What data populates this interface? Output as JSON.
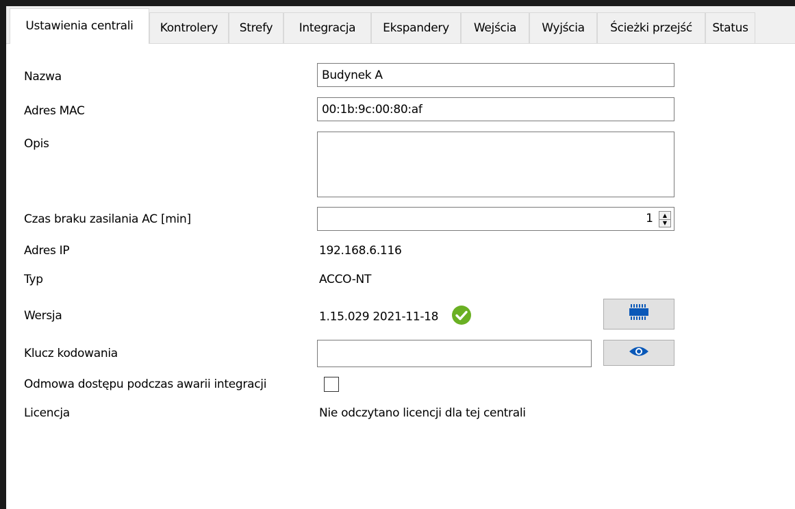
{
  "tabs": [
    {
      "label": "Ustawienia centrali",
      "active": true
    },
    {
      "label": "Kontrolery"
    },
    {
      "label": "Strefy"
    },
    {
      "label": "Integracja"
    },
    {
      "label": "Ekspandery"
    },
    {
      "label": "Wejścia"
    },
    {
      "label": "Wyjścia"
    },
    {
      "label": "Ścieżki przejść"
    },
    {
      "label": "Status"
    }
  ],
  "form": {
    "name_label": "Nazwa",
    "name_value": "Budynek A",
    "mac_label": "Adres MAC",
    "mac_value": "00:1b:9c:00:80:af",
    "desc_label": "Opis",
    "desc_value": "",
    "ac_label": "Czas braku zasilania AC [min]",
    "ac_value": "1",
    "ip_label": "Adres IP",
    "ip_value": "192.168.6.116",
    "type_label": "Typ",
    "type_value": "ACCO-NT",
    "version_label": "Wersja",
    "version_value": "1.15.029 2021-11-18",
    "key_label": "Klucz kodowania",
    "key_value": "",
    "deny_label": "Odmowa dostępu podczas awarii integracji",
    "deny_checked": false,
    "license_label": "Licencja",
    "license_value": "Nie odczytano licencji dla tej centrali"
  },
  "icons": {
    "version_status": "check-circle-icon",
    "firmware_button": "chip-icon",
    "show_key_button": "eye-icon"
  },
  "colors": {
    "check_green": "#6ab023",
    "icon_blue": "#0a58b8"
  }
}
